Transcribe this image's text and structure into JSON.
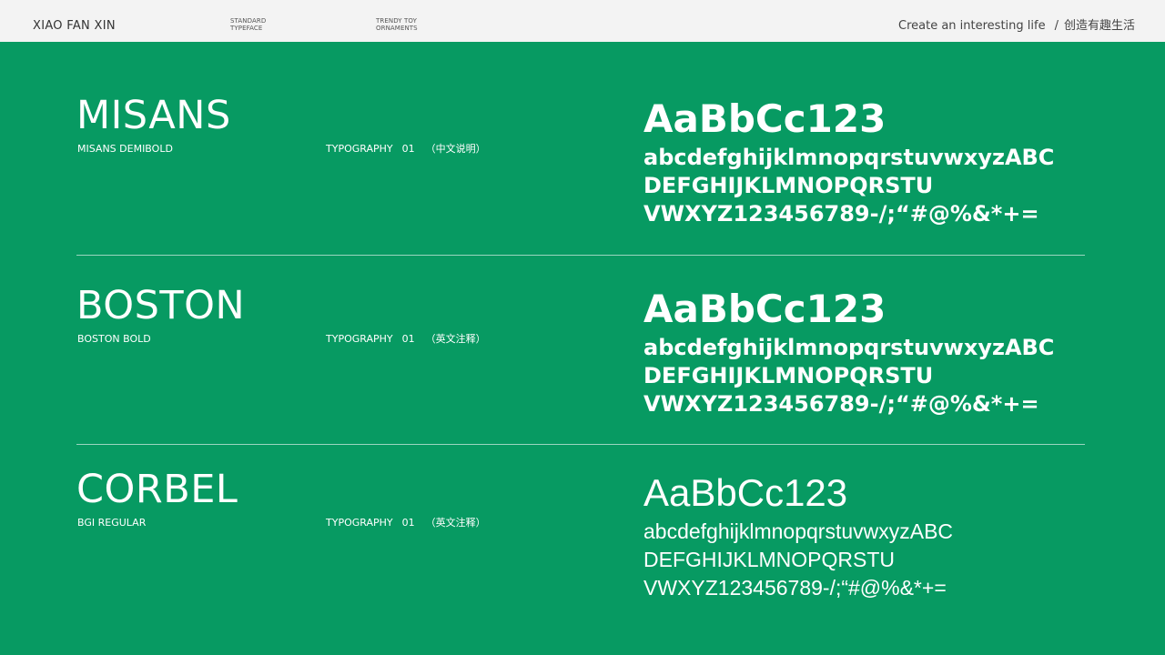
{
  "header": {
    "brand": "XIAO FAN XIN",
    "nav": [
      {
        "line1": "STANDARD",
        "line2": "TYPEFACE"
      },
      {
        "line1": "TRENDY TOY",
        "line2": "ORNAMENTS"
      }
    ],
    "tagline_en": "Create an interesting life",
    "tagline_sep": "/",
    "tagline_cn": "创造有趣生活"
  },
  "sections": [
    {
      "name": "MISANS",
      "subtitle": "MISANS DEMIBOLD",
      "typography_label": "TYPOGRAPHY",
      "number": "01",
      "note": "（中文说明）",
      "sample_large": "AaBbCc123",
      "sample_lines": [
        "abcdefghijklmnopqrstuvwxyzABC",
        "DEFGHIJKLMNOPQRSTU",
        "VWXYZ123456789-/;“#@%&*+="
      ]
    },
    {
      "name": "BOSTON",
      "subtitle": "BOSTON BOLD",
      "typography_label": "TYPOGRAPHY",
      "number": "01",
      "note": "（英文注释）",
      "sample_large": "AaBbCc123",
      "sample_lines": [
        "abcdefghijklmnopqrstuvwxyzABC",
        "DEFGHIJKLMNOPQRSTU",
        "VWXYZ123456789-/;“#@%&*+="
      ]
    },
    {
      "name": "CORBEL",
      "subtitle": "BGI REGULAR",
      "typography_label": "TYPOGRAPHY",
      "number": "01",
      "note": "（英文注释）",
      "sample_large": "AaBbCc123",
      "sample_lines": [
        "abcdefghijklmnopqrstuvwxyzABC",
        "DEFGHIJKLMNOPQRSTU",
        "VWXYZ123456789-/;“#@%&*+="
      ]
    }
  ],
  "colors": {
    "background": "#079a62",
    "header_bg": "#f3f3f3",
    "text": "#ffffff"
  }
}
